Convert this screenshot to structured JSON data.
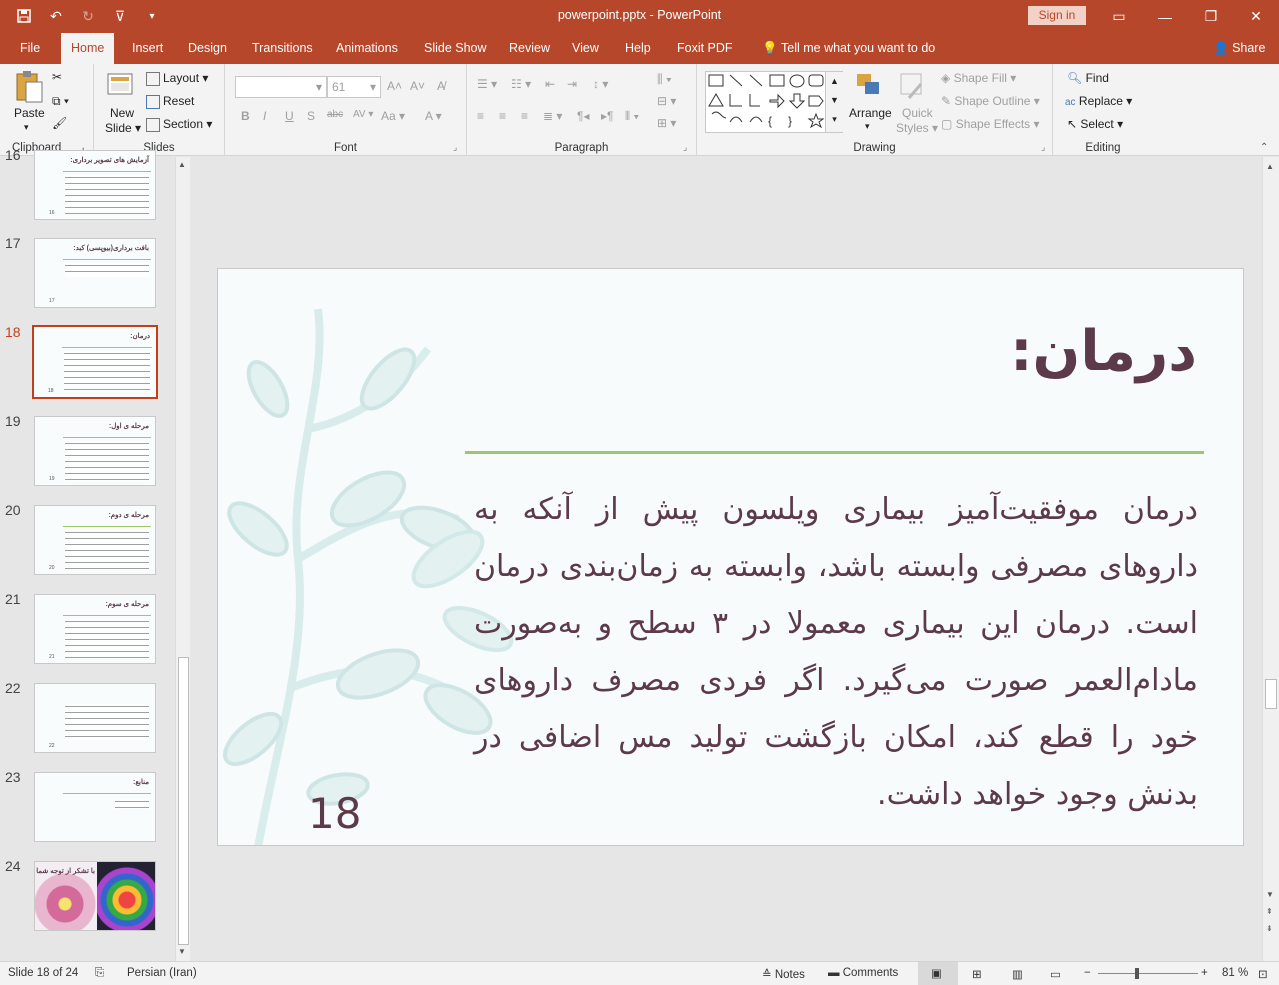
{
  "titlebar": {
    "title": "powerpoint.pptx  -  PowerPoint",
    "signin": "Sign in"
  },
  "tabs": [
    "File",
    "Home",
    "Insert",
    "Design",
    "Transitions",
    "Animations",
    "Slide Show",
    "Review",
    "View",
    "Help",
    "Foxit PDF",
    "Tell me what you want to do",
    "Share"
  ],
  "ribbon": {
    "clipboard": {
      "label": "Clipboard",
      "paste": "Paste"
    },
    "slides": {
      "label": "Slides",
      "new_slide_1": "New",
      "new_slide_2": "Slide",
      "layout": "Layout",
      "reset": "Reset",
      "section": "Section"
    },
    "font": {
      "label": "Font",
      "size": "61"
    },
    "paragraph": {
      "label": "Paragraph"
    },
    "drawing": {
      "label": "Drawing",
      "arrange": "Arrange",
      "quick_styles_1": "Quick",
      "quick_styles_2": "Styles",
      "shape_fill": "Shape Fill",
      "shape_outline": "Shape Outline",
      "shape_effects": "Shape Effects"
    },
    "editing": {
      "label": "Editing",
      "find": "Find",
      "replace": "Replace",
      "select": "Select"
    }
  },
  "thumbnails": [
    {
      "num": "16",
      "title": "آزمایش های تصویر برداری:",
      "n": "16"
    },
    {
      "num": "17",
      "title": "بافت برداری(بیوپسی) کبد:",
      "n": "17"
    },
    {
      "num": "18",
      "title": "درمان:",
      "n": "18"
    },
    {
      "num": "19",
      "title": "مرحله ی اول:",
      "n": "19"
    },
    {
      "num": "20",
      "title": "مرحله ی دوم:",
      "n": "20"
    },
    {
      "num": "21",
      "title": "مرحله ی سوم:",
      "n": "21"
    },
    {
      "num": "22",
      "title": "",
      "n": "22"
    },
    {
      "num": "23",
      "title": "منابع:",
      "n": ""
    },
    {
      "num": "24",
      "title": "با تشکر از توجه شما",
      "n": ""
    }
  ],
  "slide": {
    "title": "درمان:",
    "body": "درمان موفقیت‌آمیز بیماری ویلسون پیش از آنکه به داروهای مصرفی وابسته باشد، وابسته به زمان‌بندی درمان است. درمان این بیماری معمولا در ۳ سطح و به‌صورت مادام‌العمر صورت می‌گیرد. اگر فردی مصرف داروهای خود را قطع کند، امکان بازگشت تولید مس اضافی در بدنش وجود خواهد داشت.",
    "number": "18"
  },
  "status": {
    "slide_of": "Slide 18 of 24",
    "language": "Persian (Iran)",
    "notes": "Notes",
    "comments": "Comments",
    "zoom": "81 %"
  },
  "colors": {
    "accent": "#b7472a",
    "title": "#5c3a4a",
    "rule": "#9dc76b"
  }
}
